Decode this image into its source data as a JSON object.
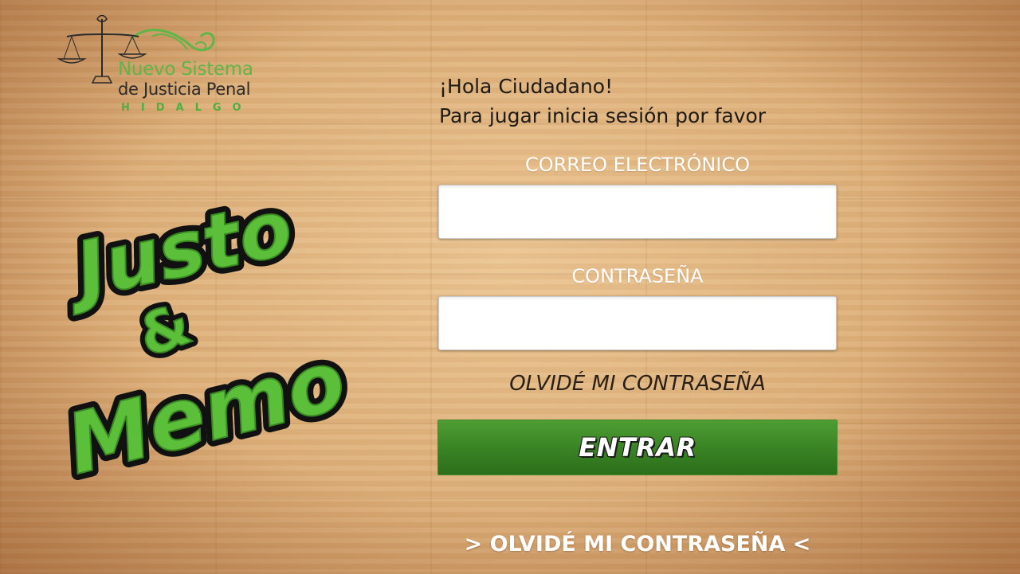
{
  "logo": {
    "line1": "Nuevo Sistema",
    "line2": "de Justicia Penal",
    "line3": "HIDALGO",
    "icon": "scales-of-justice-icon"
  },
  "game_title": {
    "word1": "Justo",
    "connector": "&",
    "word2": "Memo",
    "color": "#5cbf3a"
  },
  "greeting": {
    "line1": "¡Hola Ciudadano!",
    "line2": "Para jugar inicia sesión por favor"
  },
  "form": {
    "email_label": "CORREO ELECTRÓNICO",
    "email_value": "",
    "password_label": "CONTRASEÑA",
    "password_value": "",
    "forgot_inline": "OLVIDÉ MI CONTRASEÑA",
    "submit_label": "ENTRAR"
  },
  "footer": {
    "forgot_link": "> OLVIDÉ MI CONTRASEÑA <"
  },
  "colors": {
    "accent_green": "#3a8425",
    "logo_green": "#5fb548",
    "wood_background": "#dcae78"
  }
}
